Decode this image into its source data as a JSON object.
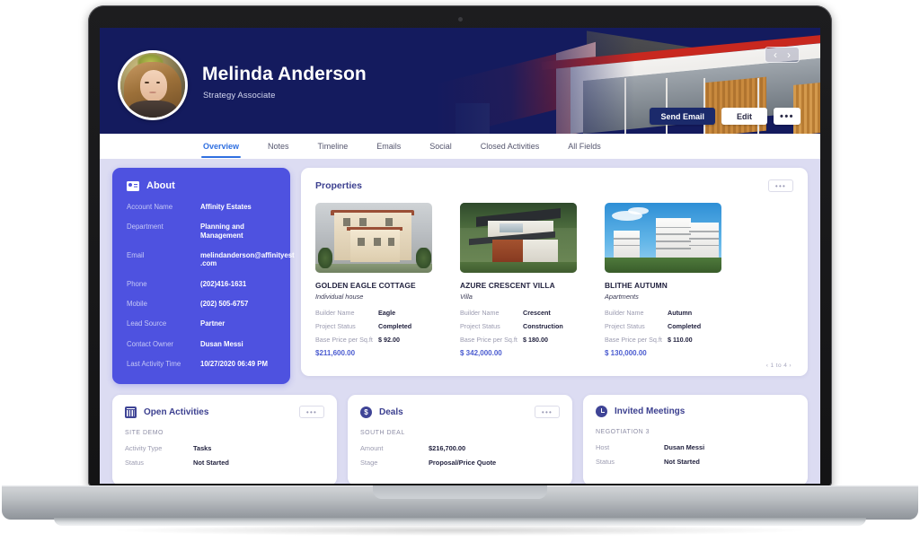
{
  "header": {
    "name": "Melinda Anderson",
    "role": "Strategy Associate",
    "prev_arrow": "‹",
    "next_arrow": "›",
    "send_email_label": "Send Email",
    "edit_label": "Edit",
    "more_label": "•••",
    "banner_color": "#141b5e"
  },
  "tabs": [
    {
      "label": "Overview",
      "active": true
    },
    {
      "label": "Notes",
      "active": false
    },
    {
      "label": "Timeline",
      "active": false
    },
    {
      "label": "Emails",
      "active": false
    },
    {
      "label": "Social",
      "active": false
    },
    {
      "label": "Closed Activities",
      "active": false
    },
    {
      "label": "All Fields",
      "active": false
    }
  ],
  "about": {
    "title": "About",
    "icon": "id-card-icon",
    "accent": "#4e52e0",
    "rows": [
      {
        "key": "Account Name",
        "value": "Affinity Estates"
      },
      {
        "key": "Department",
        "value": "Planning and Management"
      },
      {
        "key": "Email",
        "value": "melindanderson@affinityest .com"
      },
      {
        "key": "Phone",
        "value": "(202)416-1631"
      },
      {
        "key": "Mobile",
        "value": "(202) 505-6757"
      },
      {
        "key": "Lead Source",
        "value": "Partner"
      },
      {
        "key": "Contact Owner",
        "value": "Dusan Messi"
      },
      {
        "key": "Last Activity Time",
        "value": "10/27/2020   06:49 PM"
      }
    ]
  },
  "properties": {
    "title": "Properties",
    "more_label": "•••",
    "pager": "‹ 1 to 4 ›",
    "items": [
      {
        "name": "GOLDEN EAGLE COTTAGE",
        "type": "Individual house",
        "rows": [
          {
            "key": "Builder Name",
            "value": "Eagle"
          },
          {
            "key": "Project Status",
            "value": "Completed"
          },
          {
            "key": "Base Price per Sq.ft",
            "value": "$ 92.00"
          }
        ],
        "total": "$211,600.00"
      },
      {
        "name": "AZURE CRESCENT VILLA",
        "type": "Villa",
        "rows": [
          {
            "key": "Builder Name",
            "value": "Crescent"
          },
          {
            "key": "Project Status",
            "value": "Construction"
          },
          {
            "key": "Base Price per Sq.ft",
            "value": "$ 180.00"
          }
        ],
        "total": "$ 342,000.00"
      },
      {
        "name": "BLITHE AUTUMN",
        "type": "Apartments",
        "rows": [
          {
            "key": "Builder Name",
            "value": "Autumn"
          },
          {
            "key": "Project Status",
            "value": "Completed"
          },
          {
            "key": "Base Price per Sq.ft",
            "value": "$ 110.00"
          }
        ],
        "total": "$ 130,000.00"
      }
    ]
  },
  "open_activities": {
    "title": "Open Activities",
    "icon": "calendar-icon",
    "more_label": "•••",
    "subtitle": "SITE DEMO",
    "rows": [
      {
        "key": "Activity Type",
        "value": "Tasks"
      },
      {
        "key": "Status",
        "value": "Not Started"
      }
    ]
  },
  "deals": {
    "title": "Deals",
    "icon": "dollar-icon",
    "more_label": "•••",
    "subtitle": "SOUTH DEAL",
    "rows": [
      {
        "key": "Amount",
        "value": "$216,700.00"
      },
      {
        "key": "Stage",
        "value": "Proposal/Price Quote"
      }
    ]
  },
  "invited_meetings": {
    "title": "Invited Meetings",
    "icon": "clock-icon",
    "subtitle": "NEGOTIATION 3",
    "rows": [
      {
        "key": "Host",
        "value": "Dusan Messi"
      },
      {
        "key": "Status",
        "value": "Not Started"
      }
    ]
  }
}
